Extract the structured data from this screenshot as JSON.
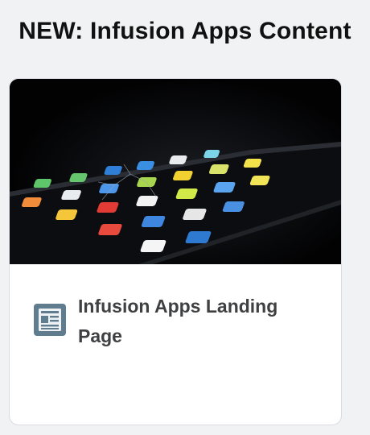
{
  "section": {
    "title": "NEW: Infusion Apps Content"
  },
  "card": {
    "image_alt": "smartphone home screen with app icons",
    "icon": "document-article-icon",
    "title": "Infusion Apps Landing Page"
  },
  "colors": {
    "page_background": "#f1f2f4",
    "card_background": "#ffffff",
    "title_text": "#111111",
    "card_text": "#3f4042",
    "icon": "#5f7d8e"
  }
}
